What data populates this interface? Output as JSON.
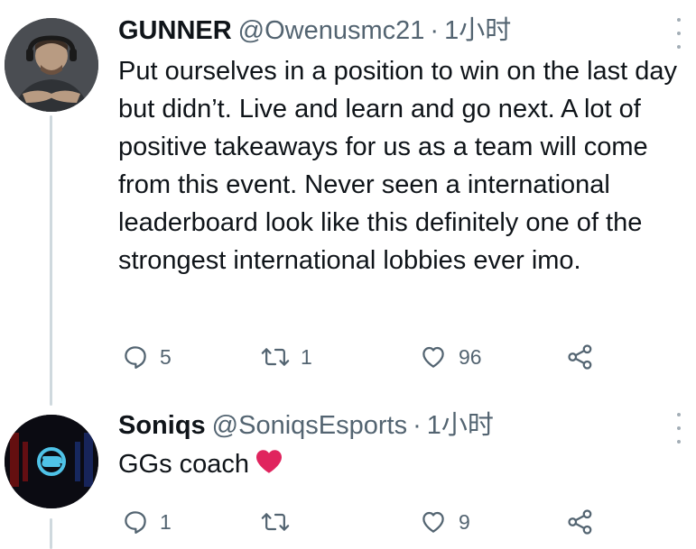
{
  "tweets": [
    {
      "display_name": "GUNNER",
      "handle": "@Owenusmc21",
      "separator": "·",
      "timestamp": "1小时",
      "text": "Put ourselves in a position to win on the last day but didn’t. Live and learn and go next. A lot of positive takeaways for us as a team will come from this event. Never seen a international leaderboard look like this definitely one of the strongest international lobbies ever imo.",
      "reply_count": "5",
      "retweet_count": "1",
      "like_count": "96"
    },
    {
      "display_name": "Soniqs",
      "handle": "@SoniqsEsports",
      "separator": "·",
      "timestamp": "1小时",
      "text": "GGs coach",
      "reply_count": "1",
      "retweet_count": "",
      "like_count": "9"
    }
  ],
  "icons": {
    "reply": "reply-icon",
    "retweet": "retweet-icon",
    "like": "heart-icon",
    "share": "share-icon",
    "more": "more-vertical-icon",
    "emoji": "red-heart-emoji"
  },
  "colors": {
    "text_primary": "#0f1419",
    "text_secondary": "#536471",
    "thread_line": "#cfd9de",
    "emoji_red": "#e0245e",
    "soniqs_accent": "#4fc3e8"
  }
}
